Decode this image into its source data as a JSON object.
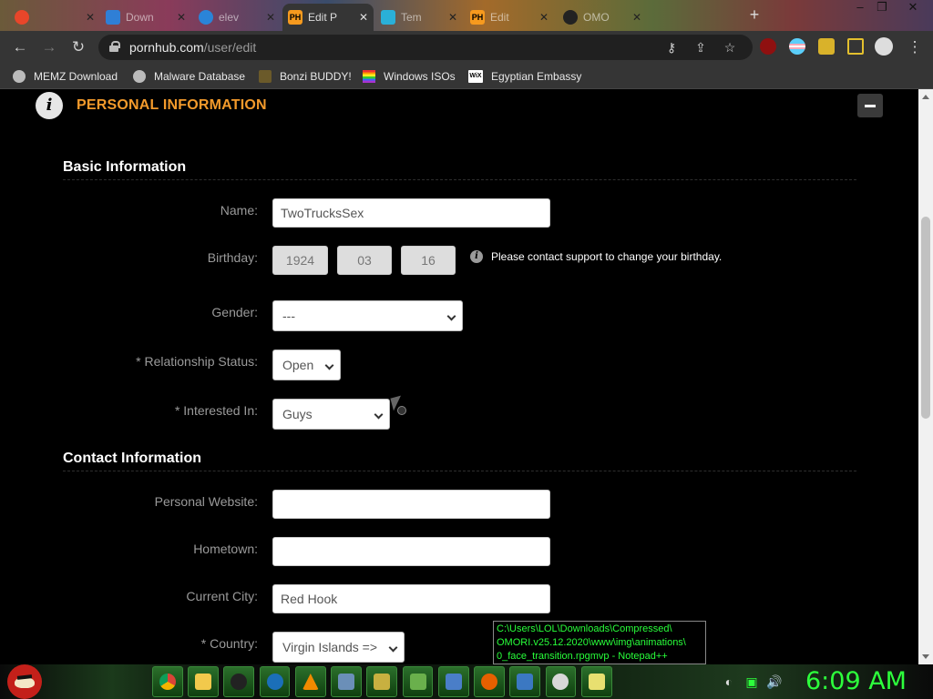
{
  "browser": {
    "tabs": [
      {
        "title": "",
        "fav_color": "#e8462a",
        "active": false
      },
      {
        "title": "Down",
        "fav_color": "#2f7fd6",
        "active": false
      },
      {
        "title": "elev",
        "fav_color": "#2a84d8",
        "active": false
      },
      {
        "title": "Edit P",
        "fav_text": "PH",
        "fav_color": "#f79a1e",
        "active": true
      },
      {
        "title": "Tem",
        "fav_color": "#2ab0d8",
        "active": false
      },
      {
        "title": "Edit",
        "fav_text": "PH",
        "fav_color": "#f79a1e",
        "active": false
      },
      {
        "title": "OMO",
        "fav_color": "#222222",
        "active": false
      }
    ],
    "url_host": "pornhub.com",
    "url_path": "/user/edit",
    "bookmarks": [
      {
        "label": "MEMZ Download"
      },
      {
        "label": "Malware Database"
      },
      {
        "label": "Bonzi BUDDY!"
      },
      {
        "label": "Windows ISOs"
      },
      {
        "label": "Egyptian Embassy"
      }
    ],
    "fav_wix": "WiX"
  },
  "panel": {
    "title": "PERSONAL INFORMATION",
    "info_glyph": "i"
  },
  "basic": {
    "heading": "Basic Information",
    "name_label": "Name:",
    "name_value": "TwoTrucksSex",
    "birthday_label": "Birthday:",
    "birth_year": "1924",
    "birth_month": "03",
    "birth_day": "16",
    "birthday_hint": "Please contact support to change your birthday.",
    "gender_label": "Gender:",
    "gender_value": "---",
    "relationship_label": "* Relationship Status:",
    "relationship_value": "Open",
    "interested_label": "* Interested In:",
    "interested_value": "Guys"
  },
  "contact": {
    "heading": "Contact Information",
    "website_label": "Personal Website:",
    "website_value": "",
    "hometown_label": "Hometown:",
    "hometown_value": "",
    "city_label": "Current City:",
    "city_value": "Red Hook",
    "country_label": "* Country:",
    "country_value": "Virgin Islands =>"
  },
  "tooltip": {
    "line1": "C:\\Users\\LOL\\Downloads\\Compressed\\",
    "line2": "OMORI.v25.12.2020\\www\\img\\animations\\",
    "line3": "0_face_transition.rpgmvp - Notepad++"
  },
  "taskbar": {
    "clock": "6:09 AM"
  },
  "colors": {
    "accent": "#f39a2b",
    "clock": "#2dff3c"
  }
}
